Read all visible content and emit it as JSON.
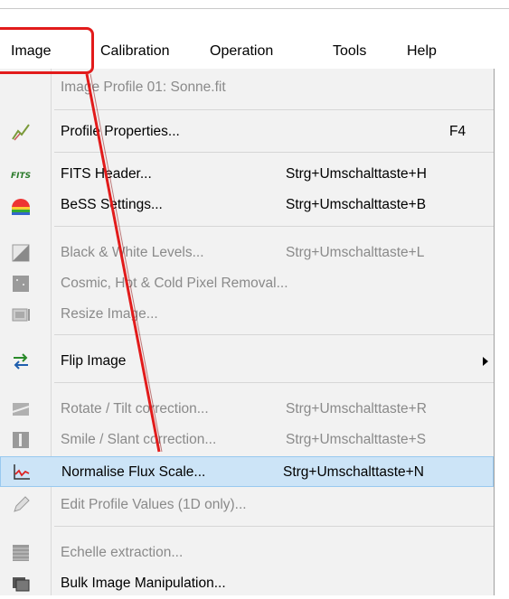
{
  "menubar": {
    "items": [
      {
        "label": "Image"
      },
      {
        "label": "Calibration"
      },
      {
        "label": "Operation"
      },
      {
        "label": "Tools"
      },
      {
        "label": "Help"
      }
    ]
  },
  "menu": {
    "header": "Image Profile 01: Sonne.fit",
    "items": [
      {
        "label": "Profile Properties...",
        "shortcut": "F4",
        "icon": "profile-properties-icon",
        "enabled": true
      },
      {
        "label": "FITS Header...",
        "shortcut": "Strg+Umschalttaste+H",
        "icon": "fits-icon",
        "enabled": true
      },
      {
        "label": "BeSS Settings...",
        "shortcut": "Strg+Umschalttaste+B",
        "icon": "bess-icon",
        "enabled": true
      },
      {
        "label": "Black & White Levels...",
        "shortcut": "Strg+Umschalttaste+L",
        "icon": "levels-icon",
        "enabled": false
      },
      {
        "label": "Cosmic, Hot & Cold Pixel Removal...",
        "shortcut": "",
        "icon": "pixel-removal-icon",
        "enabled": false
      },
      {
        "label": "Resize Image...",
        "shortcut": "",
        "icon": "resize-icon",
        "enabled": false
      },
      {
        "label": "Flip Image",
        "shortcut": "",
        "icon": "flip-icon",
        "enabled": true,
        "submenu": true
      },
      {
        "label": "Rotate / Tilt correction...",
        "shortcut": "Strg+Umschalttaste+R",
        "icon": "rotate-icon",
        "enabled": false
      },
      {
        "label": "Smile / Slant correction...",
        "shortcut": "Strg+Umschalttaste+S",
        "icon": "smile-icon",
        "enabled": false
      },
      {
        "label": "Normalise Flux Scale...",
        "shortcut": "Strg+Umschalttaste+N",
        "icon": "flux-scale-icon",
        "enabled": true,
        "highlighted": true
      },
      {
        "label": "Edit Profile Values (1D only)...",
        "shortcut": "",
        "icon": "pencil-icon",
        "enabled": false
      },
      {
        "label": "Echelle extraction...",
        "shortcut": "",
        "icon": "echelle-icon",
        "enabled": false
      },
      {
        "label": "Bulk Image Manipulation...",
        "shortcut": "",
        "icon": "bulk-icon",
        "enabled": true
      }
    ]
  },
  "colors": {
    "annotation": "#e21b1b",
    "highlight": "#cce4f7",
    "menu_bg": "#f2f2f2",
    "disabled_text": "#8a8a8a"
  }
}
